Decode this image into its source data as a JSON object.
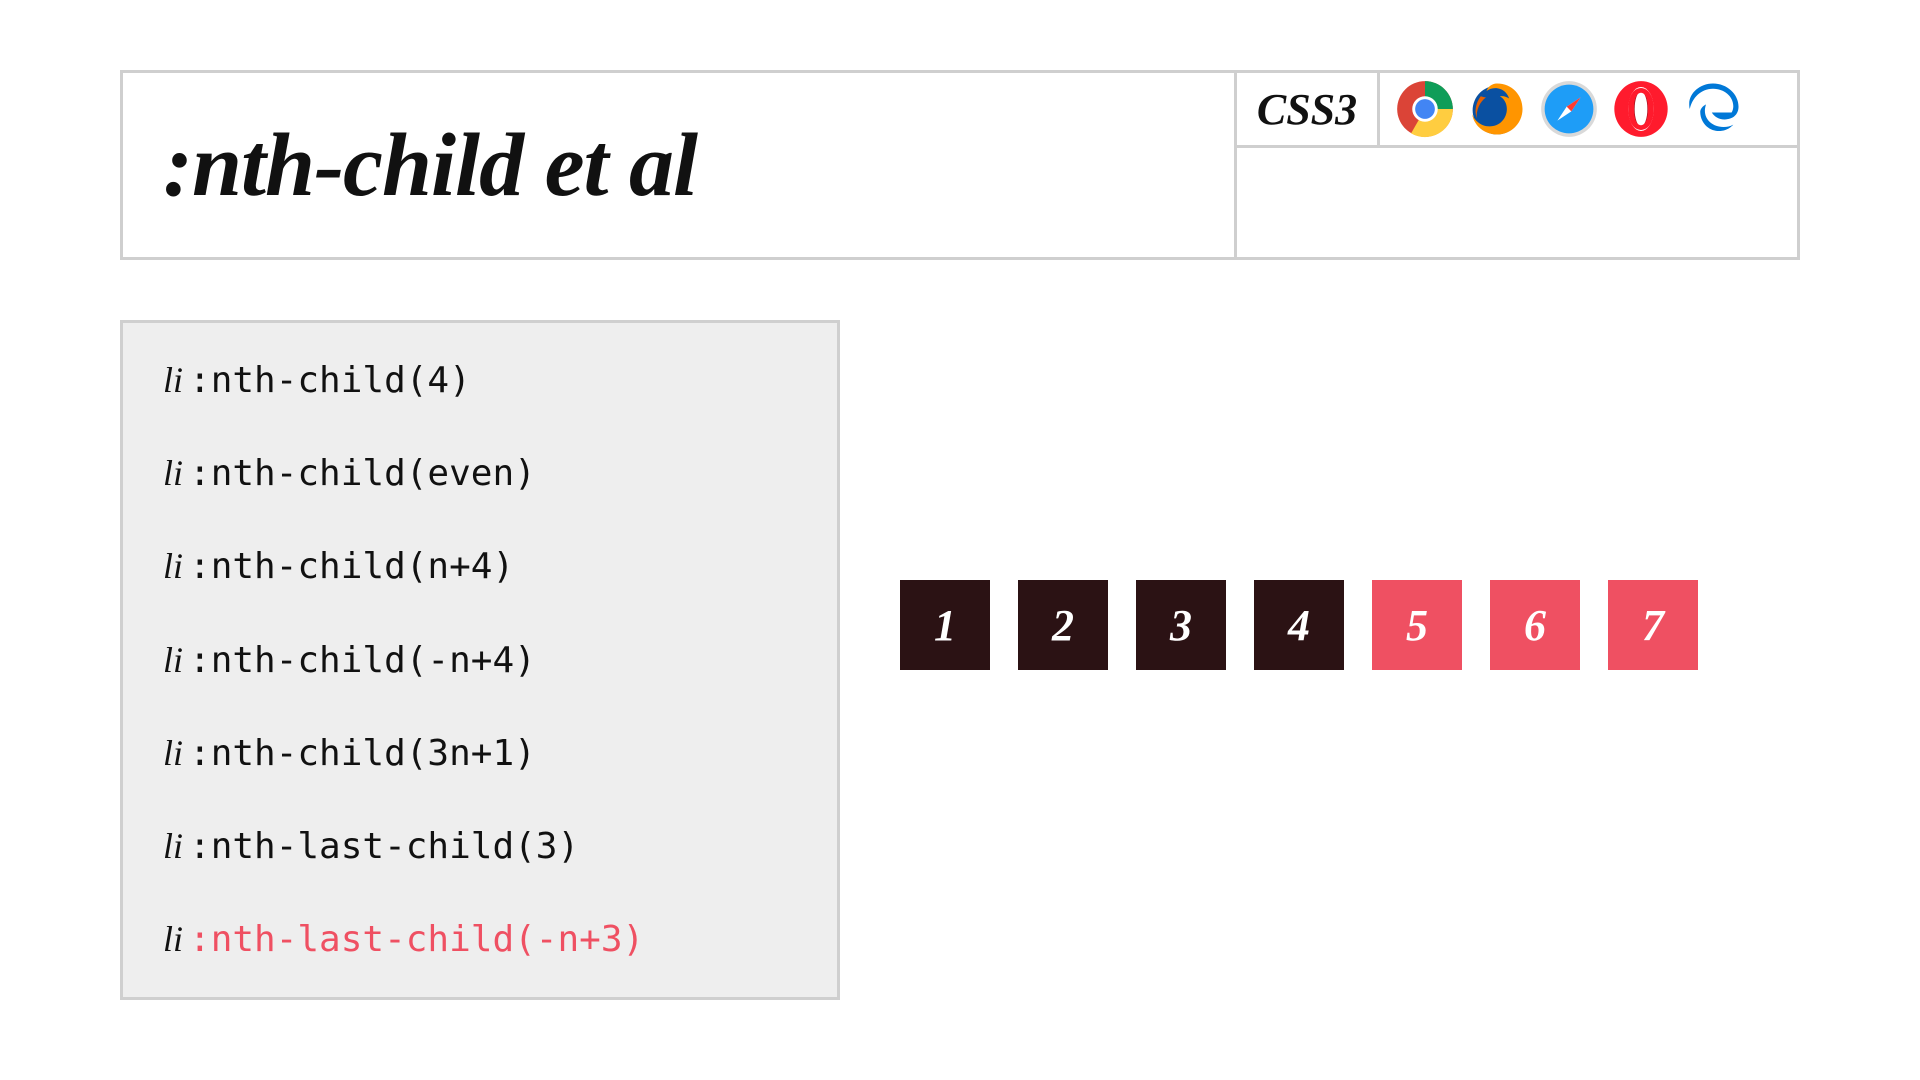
{
  "header": {
    "title": ":nth-child et al",
    "spec": "CSS3",
    "browsers": [
      "chrome-icon",
      "firefox-icon",
      "safari-icon",
      "opera-icon",
      "edge-icon"
    ]
  },
  "code": {
    "tag": "li",
    "lines": [
      {
        "selector": ":nth-child(4)",
        "active": false
      },
      {
        "selector": ":nth-child(even)",
        "active": false
      },
      {
        "selector": ":nth-child(n+4)",
        "active": false
      },
      {
        "selector": ":nth-child(-n+4)",
        "active": false
      },
      {
        "selector": ":nth-child(3n+1)",
        "active": false
      },
      {
        "selector": ":nth-last-child(3)",
        "active": false
      },
      {
        "selector": ":nth-last-child(-n+3)",
        "active": true
      }
    ]
  },
  "demo": {
    "items": [
      {
        "label": "1",
        "highlight": false
      },
      {
        "label": "2",
        "highlight": false
      },
      {
        "label": "3",
        "highlight": false
      },
      {
        "label": "4",
        "highlight": false
      },
      {
        "label": "5",
        "highlight": true
      },
      {
        "label": "6",
        "highlight": true
      },
      {
        "label": "7",
        "highlight": true
      }
    ]
  },
  "colors": {
    "accent": "#ef5062",
    "box_dark": "#2b1214",
    "panel_bg": "#eeeeee",
    "border": "#cfcfcf"
  }
}
